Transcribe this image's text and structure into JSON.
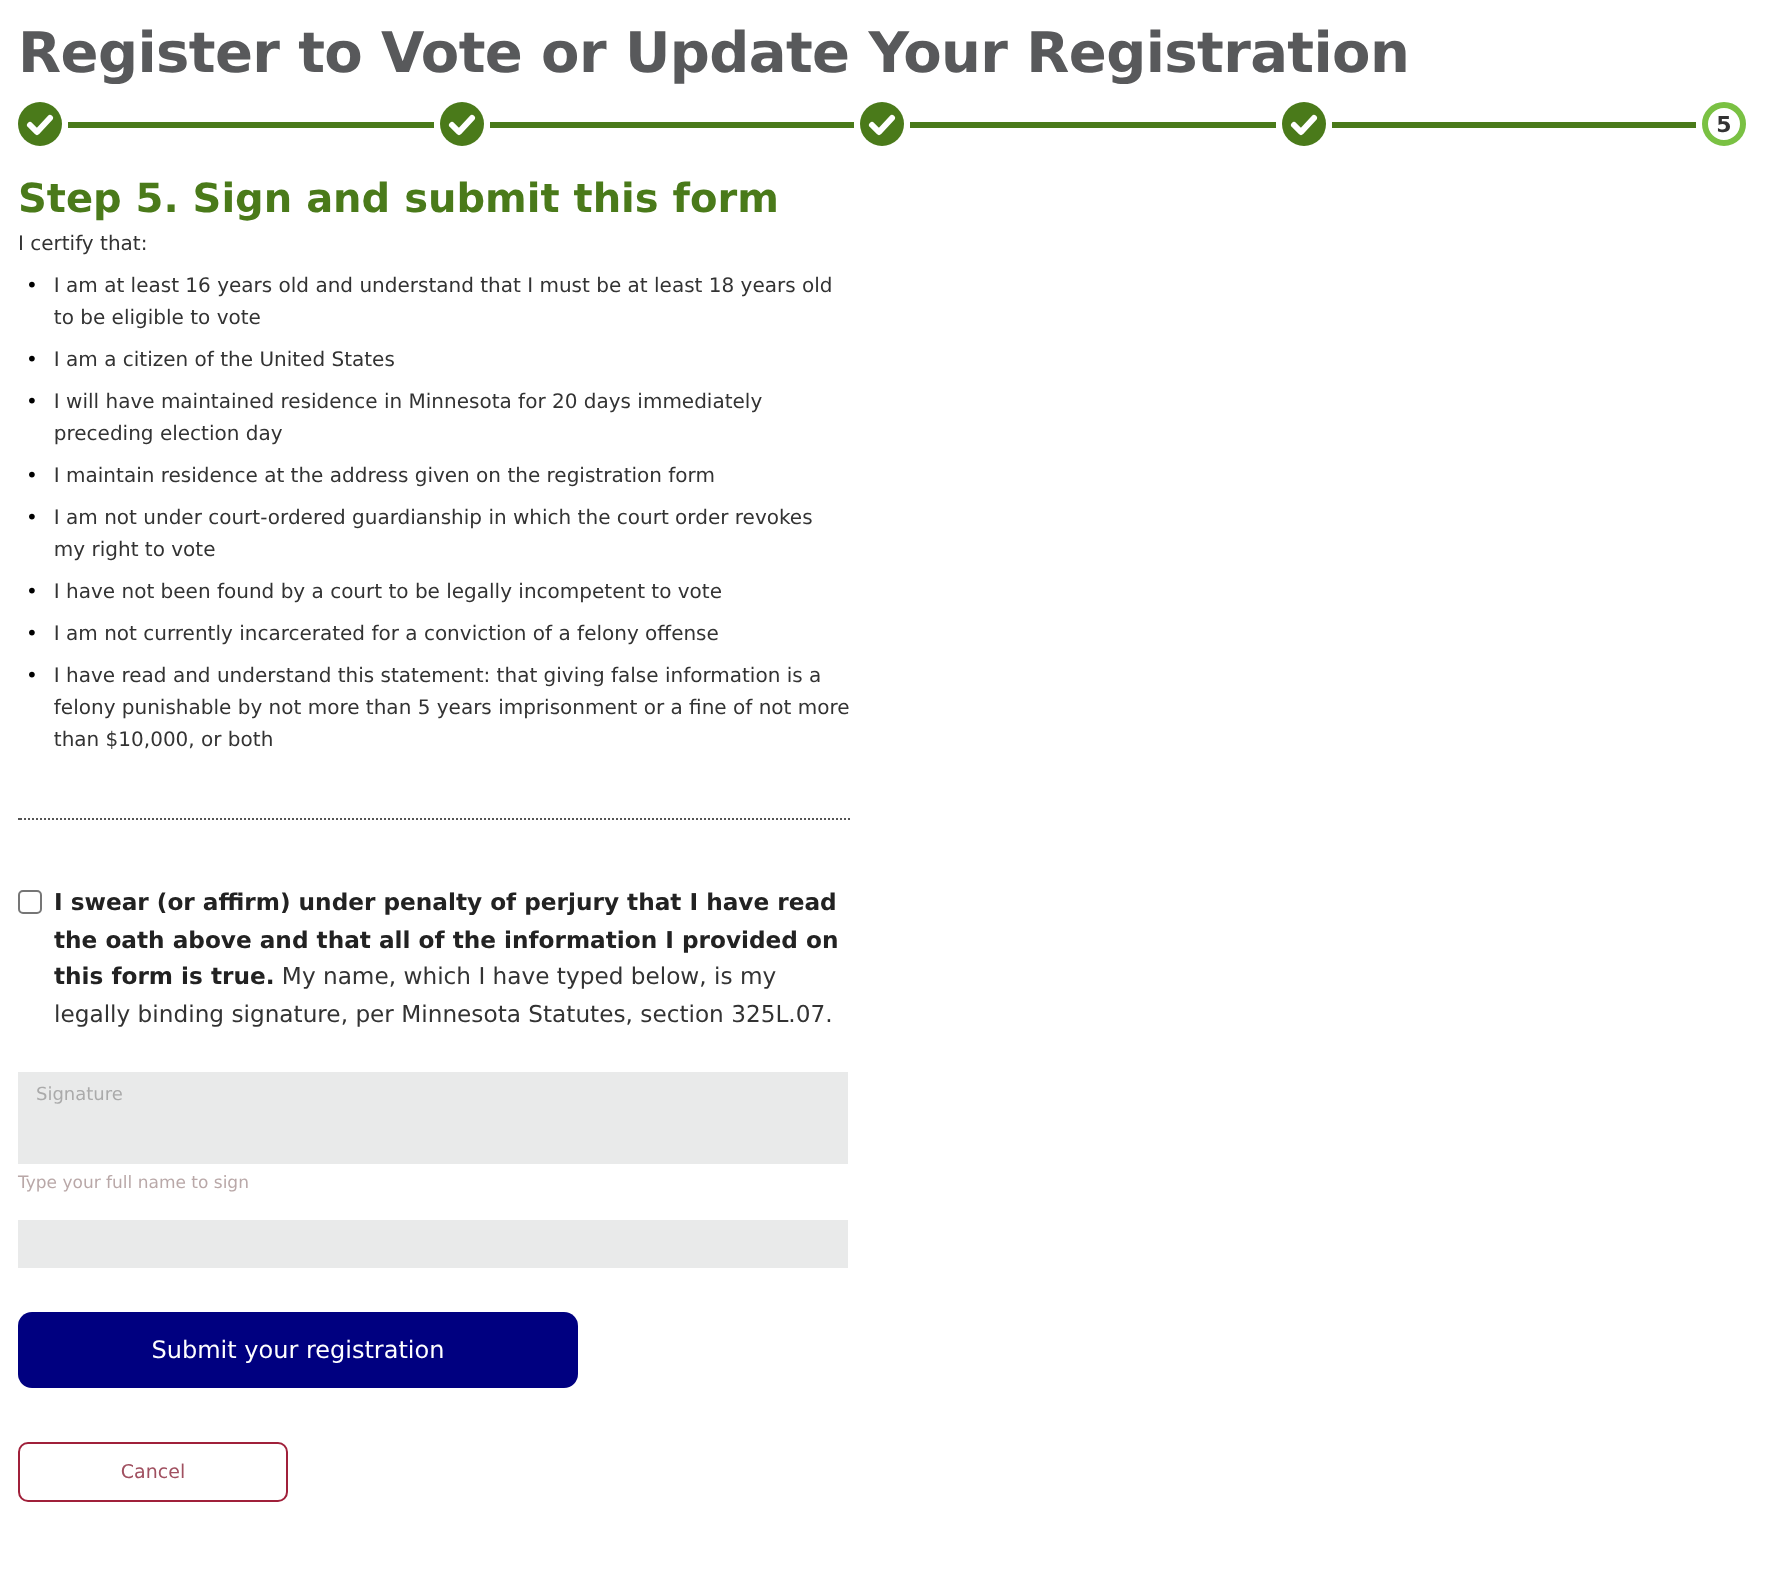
{
  "title": "Register to Vote or Update Your Registration",
  "steps": [
    {
      "done": true
    },
    {
      "done": true
    },
    {
      "done": true
    },
    {
      "done": true
    },
    {
      "done": false,
      "label": "5"
    }
  ],
  "bullet": "•",
  "heading": "Step 5. Sign and submit this form",
  "intro": "I certify that:",
  "statements": [
    "I am at least 16 years old and understand that I must be at least 18 years old to be eligible to vote",
    "I am a citizen of the United States",
    "I will have maintained residence in Minnesota for 20 days immediately preceding election day",
    "I maintain residence at the address given on the registration form",
    "I am not under court-ordered guardianship in which the court order revokes my right to vote",
    "I have not been found by a court to be legally incompetent to vote",
    "I am not currently incarcerated for a conviction of a felony offense",
    "I have read and understand this statement: that giving false information is a felony punishable by not more than 5 years imprisonment or a fine of not more than $10,000, or both"
  ],
  "oath": {
    "checked": false,
    "text": "**I swear (or affirm) under penalty of perjury that I have read the oath above and that all of the information I provided on this form is true.** My name, which I have typed below, is my legally binding signature, per Minnesota Statutes, section 325L.07."
  },
  "signature": {
    "placeholder": "Signature",
    "hint": "Type your full name to sign"
  },
  "buttons": {
    "submit": "Submit your registration",
    "cancel": "Cancel"
  }
}
